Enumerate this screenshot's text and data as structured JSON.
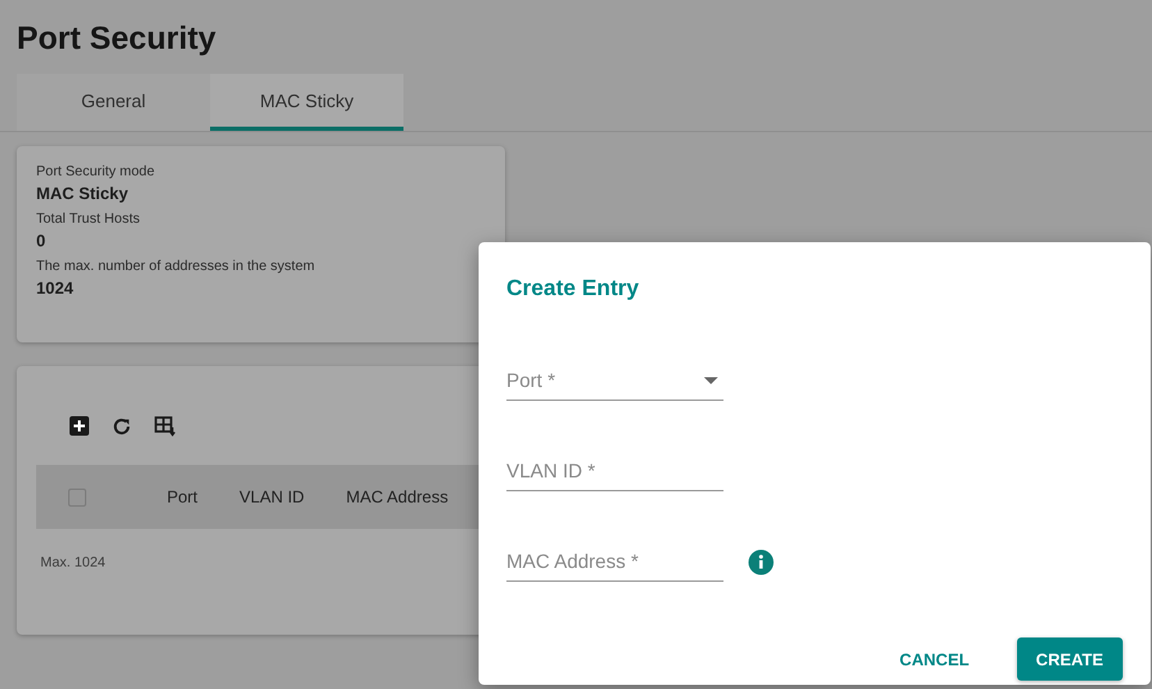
{
  "page": {
    "title": "Port Security"
  },
  "tabs": [
    {
      "label": "General",
      "selected": false
    },
    {
      "label": "MAC Sticky",
      "selected": true
    }
  ],
  "summary": [
    {
      "label": "Port Security mode",
      "value": "MAC Sticky"
    },
    {
      "label": "Total Trust Hosts",
      "value": "0"
    },
    {
      "label": "The max. number of addresses in the system",
      "value": "1024"
    }
  ],
  "table": {
    "select_all": {
      "checked": false
    },
    "columns": [
      "Port",
      "VLAN ID",
      "MAC Address"
    ],
    "footer": "Max. 1024"
  },
  "dialog": {
    "title": "Create Entry",
    "fields": [
      {
        "kind": "select",
        "placeholder": "Port *"
      },
      {
        "kind": "text",
        "placeholder": "VLAN ID *"
      },
      {
        "kind": "info",
        "placeholder": "MAC Address *"
      }
    ],
    "buttons": [
      {
        "label": "CANCEL",
        "kind": "text"
      },
      {
        "label": "CREATE",
        "kind": "primary"
      }
    ]
  }
}
